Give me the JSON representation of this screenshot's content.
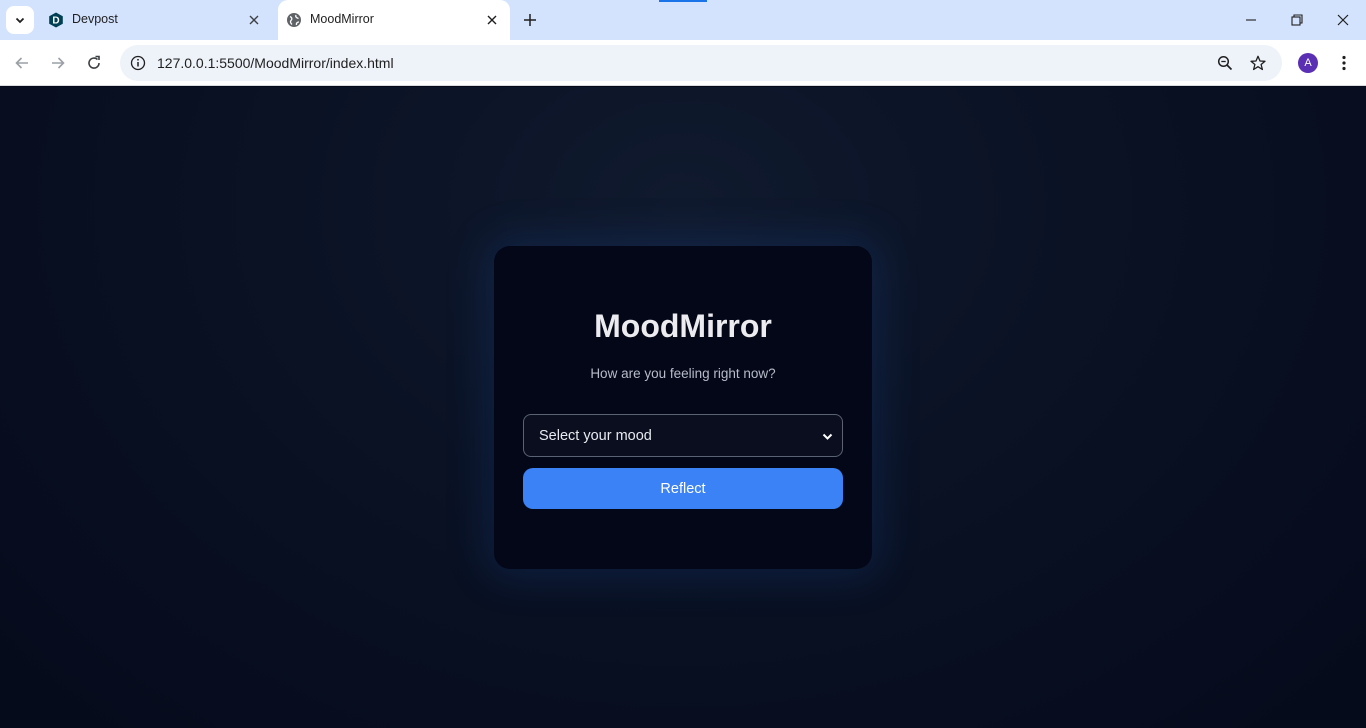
{
  "browser": {
    "tabs": [
      {
        "title": "Devpost",
        "favicon": "devpost-icon",
        "active": false
      },
      {
        "title": "MoodMirror",
        "favicon": "globe-icon",
        "active": true
      }
    ],
    "address_bar": {
      "url": "127.0.0.1:5500/MoodMirror/index.html"
    },
    "profile_initial": "A",
    "colors": {
      "tabstrip": "#d3e3fd",
      "avatar": "#5b2fb3"
    }
  },
  "app": {
    "title": "MoodMirror",
    "subtitle": "How are you feeling right now?",
    "mood_select": {
      "selected": "Select your mood"
    },
    "reflect_button": "Reflect",
    "colors": {
      "background": "#050a1a",
      "card": "#030718",
      "button": "#3b82f6"
    }
  }
}
